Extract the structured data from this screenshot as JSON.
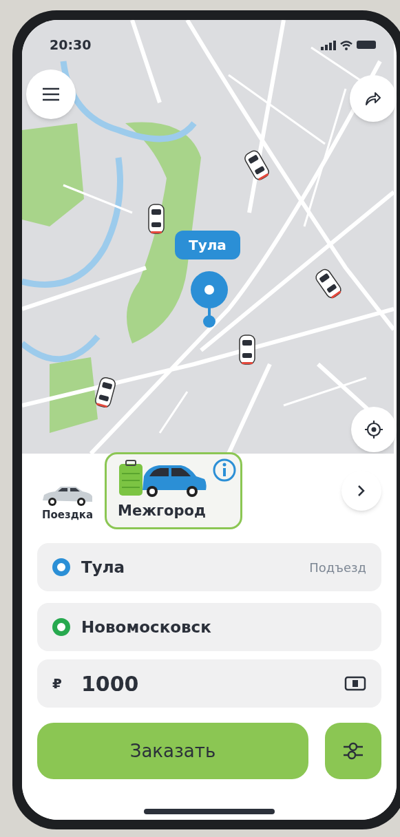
{
  "status_bar": {
    "time": "20:30"
  },
  "map": {
    "pin_label": "Тула"
  },
  "tariffs": [
    {
      "label": "Поездка",
      "selected": false
    },
    {
      "label": "Межгород",
      "selected": true
    }
  ],
  "route": [
    {
      "text": "Тула",
      "color": "#2b8fd6",
      "action": "Подъезд"
    },
    {
      "text": "Новомосковск",
      "color": "#27a94f"
    }
  ],
  "price": {
    "currency": "₽",
    "value": "1000"
  },
  "order_button": "Заказать"
}
